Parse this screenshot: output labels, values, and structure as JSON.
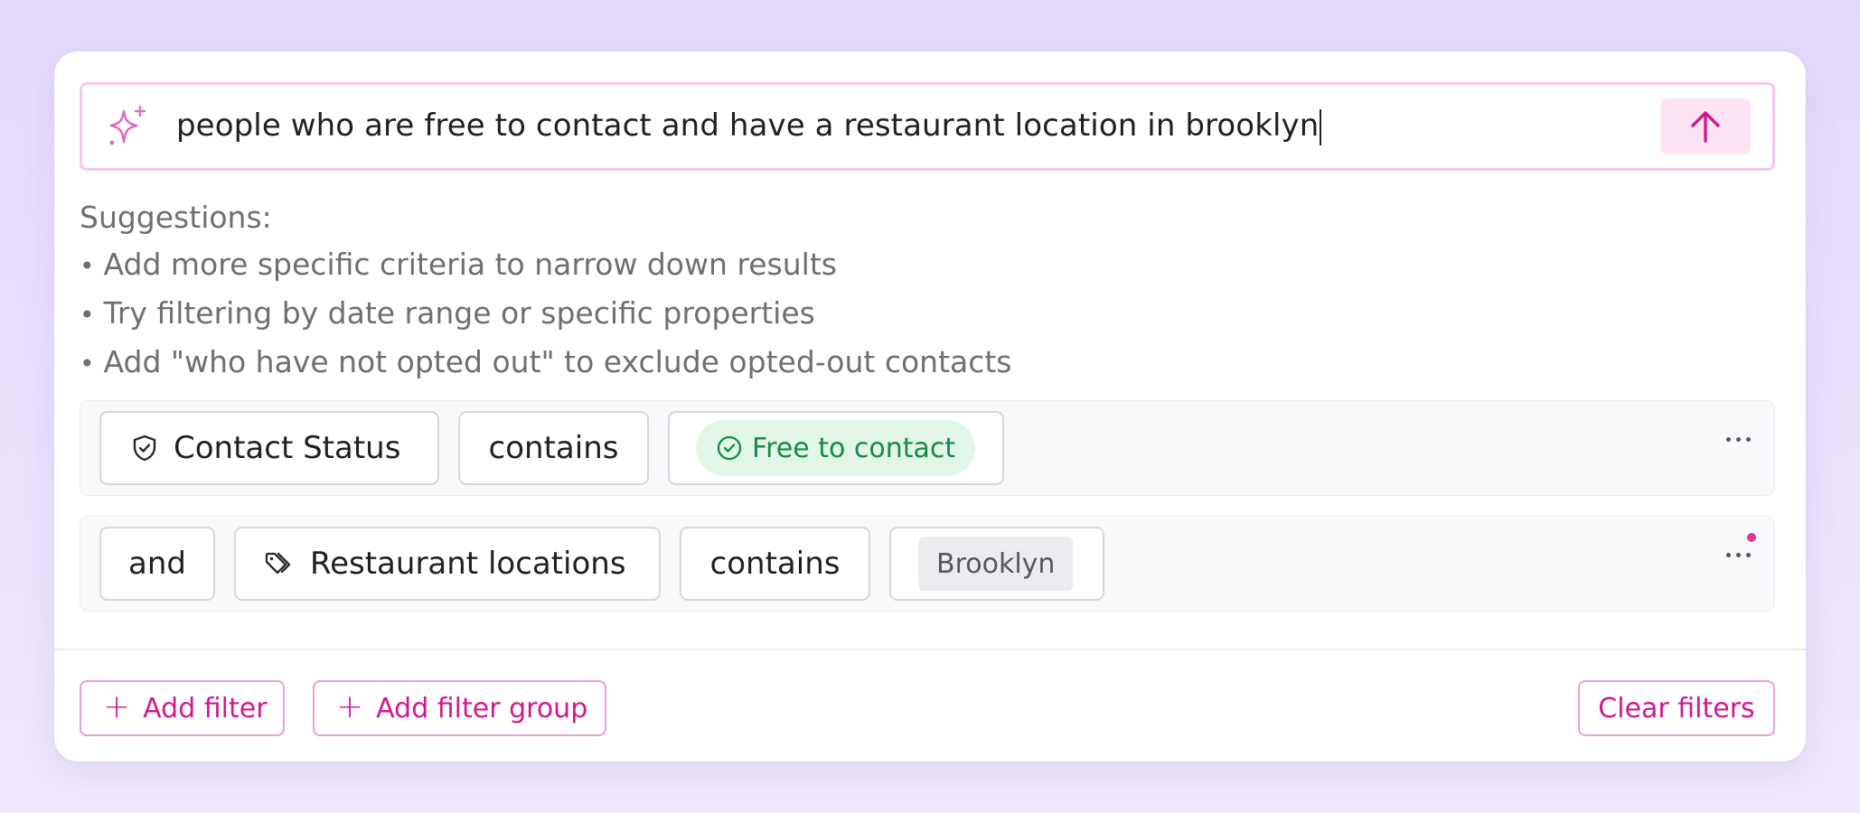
{
  "query": {
    "text": "people who are free to contact and have a restaurant location in brooklyn",
    "left_icon": "sparkle-icon",
    "submit_icon": "arrow-up-icon"
  },
  "suggestions": {
    "title": "Suggestions:",
    "items": [
      "Add more specific criteria to narrow down results",
      "Try filtering by date range or specific properties",
      "Add \"who have not opted out\" to exclude opted-out contacts"
    ]
  },
  "filters": [
    {
      "field_icon": "shield-check-icon",
      "field": "Contact Status",
      "operator": "contains",
      "value_icon": "check-circle-icon",
      "value": "Free to contact",
      "value_color": "#168a44"
    },
    {
      "connector": "and",
      "field_icon": "tag-icon",
      "field": "Restaurant locations",
      "operator": "contains",
      "value": "Brooklyn"
    }
  ],
  "footer": {
    "add_filter_label": "Add filter",
    "add_filter_group_label": "Add filter group",
    "clear_filters_label": "Clear filters"
  },
  "colors": {
    "accent": "#d1198f",
    "background": "#e4d9fc",
    "success": "#168a44"
  }
}
